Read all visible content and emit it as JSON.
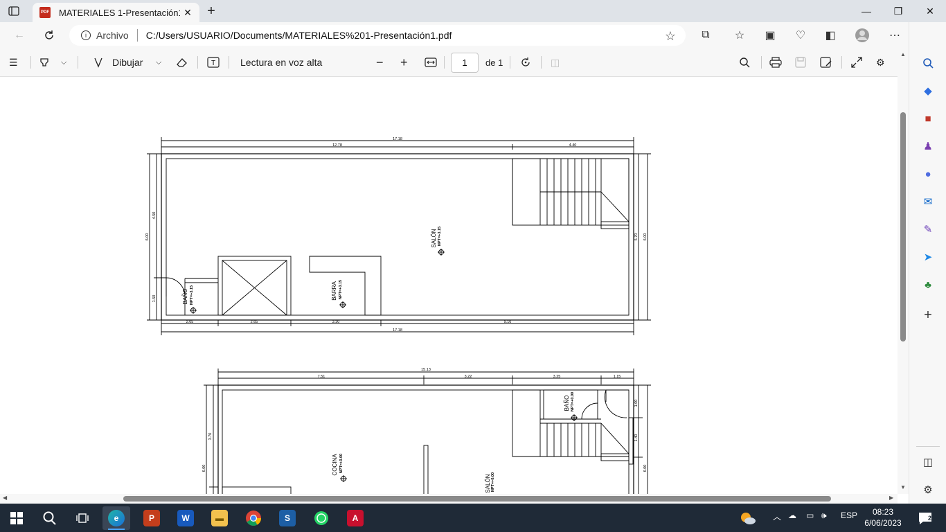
{
  "browser": {
    "tab_title": "MATERIALES 1-Presentación1.pdf",
    "pdf_badge": "PDF",
    "url_scheme": "Archivo",
    "url_path": "C:/Users/USUARIO/Documents/MATERIALES%201-Presentación1.pdf"
  },
  "pdf_toolbar": {
    "draw_label": "Dibujar",
    "read_aloud_label": "Lectura en voz alta",
    "page_number": "1",
    "page_total": "de 1"
  },
  "plan_top": {
    "overall_width": "17.18",
    "seg_top_left": "12.78",
    "seg_top_right": "4.40",
    "left_total": "6.00",
    "left_upper": "4.50",
    "left_lower": "1.50",
    "right_inner": "5.70",
    "right_total": "6.00",
    "bottom_segments": [
      "2.05",
      "2.65",
      "3.30",
      "9.16"
    ],
    "bottom_total": "17.18",
    "room_salon": "SALÓN",
    "level_salon": "NPT=+3.15",
    "room_barra": "BARRA",
    "level_barra": "NPT=+3.15",
    "room_bano": "BAÑO",
    "level_bano": "NPT=+3.15"
  },
  "plan_bottom": {
    "overall_width": "15.13",
    "segments": [
      "7.51",
      "3.22",
      "3.25",
      "1.15"
    ],
    "left_upper": "3.70",
    "left_total": "6.00",
    "right_a": "1.00",
    "right_b": "1.40",
    "right_total": "6.00",
    "room_cocina": "COCINA",
    "level_cocina": "NPT=+0.00",
    "room_bano": "BAÑO",
    "level_bano": "NPT=+0.00",
    "room_salon": "SALÓN",
    "level_salon": "NPT=+0.00"
  },
  "taskbar": {
    "language": "ESP",
    "time": "08:23",
    "date": "6/06/2023",
    "notifications": "2"
  }
}
